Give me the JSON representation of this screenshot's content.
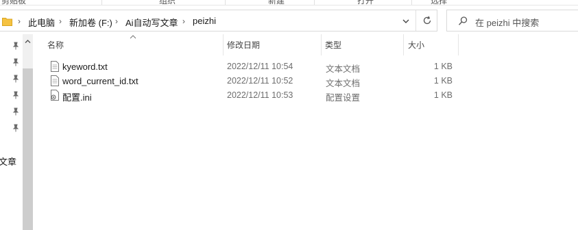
{
  "ribbon": {
    "groups": [
      "剪贴板",
      "组织",
      "新建",
      "打开",
      "选择"
    ]
  },
  "address_bar": {
    "breadcrumbs": [
      "此电脑",
      "新加卷 (F:)",
      "Ai自动写文章",
      "peizhi"
    ]
  },
  "search": {
    "placeholder": "在 peizhi 中搜索"
  },
  "nav_pane": {
    "partial_label": "文章"
  },
  "columns": {
    "name": "名称",
    "date": "修改日期",
    "type": "类型",
    "size": "大小"
  },
  "files": [
    {
      "name": "kyeword.txt",
      "date": "2022/12/11 10:54",
      "type": "文本文档",
      "size": "1 KB",
      "icon": "text-file-icon"
    },
    {
      "name": "word_current_id.txt",
      "date": "2022/12/11 10:52",
      "type": "文本文档",
      "size": "1 KB",
      "icon": "text-file-icon"
    },
    {
      "name": "配置.ini",
      "date": "2022/12/11 10:53",
      "type": "配置设置",
      "size": "1 KB",
      "icon": "config-file-icon"
    }
  ],
  "colors": {
    "folder": "#f5c242",
    "pin": "#6b6b6b",
    "scroll_thumb": "#cdcdcd"
  }
}
